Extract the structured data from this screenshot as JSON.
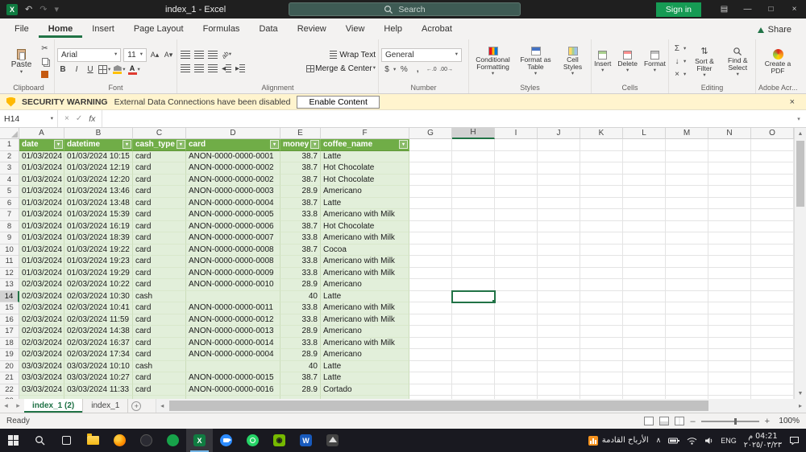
{
  "titlebar": {
    "title": "index_1 - Excel",
    "search_placeholder": "Search",
    "sign_in_label": "Sign in"
  },
  "menubar": {
    "tabs": [
      "File",
      "Home",
      "Insert",
      "Page Layout",
      "Formulas",
      "Data",
      "Review",
      "View",
      "Help",
      "Acrobat"
    ],
    "active_tab": "Home",
    "share_label": "Share"
  },
  "ribbon": {
    "clipboard": {
      "paste_label": "Paste",
      "group_label": "Clipboard"
    },
    "font": {
      "font_name": "Arial",
      "font_size": "11",
      "group_label": "Font"
    },
    "alignment": {
      "wrap_text_label": "Wrap Text",
      "merge_center_label": "Merge & Center",
      "group_label": "Alignment"
    },
    "number": {
      "format": "General",
      "group_label": "Number"
    },
    "styles": {
      "conditional_formatting_label": "Conditional Formatting",
      "format_as_table_label": "Format as Table",
      "cell_styles_label": "Cell Styles",
      "group_label": "Styles"
    },
    "cells": {
      "insert_label": "Insert",
      "delete_label": "Delete",
      "format_label": "Format",
      "group_label": "Cells"
    },
    "editing": {
      "autosum_label": "Σ",
      "sort_filter_label": "Sort & Filter",
      "find_select_label": "Find & Select",
      "group_label": "Editing"
    },
    "adobe": {
      "create_pdf_label": "Create a PDF",
      "group_label": "Adobe Acr..."
    }
  },
  "security_bar": {
    "title": "SECURITY WARNING",
    "message": "External Data Connections have been disabled",
    "button_label": "Enable Content"
  },
  "formula_bar": {
    "name_box": "H14",
    "formula_value": ""
  },
  "grid": {
    "column_letters": [
      "A",
      "B",
      "C",
      "D",
      "E",
      "F",
      "G",
      "H",
      "I",
      "J",
      "K",
      "L",
      "M",
      "N",
      "O"
    ],
    "selected_cell": {
      "column": "H",
      "row": 14
    },
    "table_headers": [
      "date",
      "datetime",
      "cash_type",
      "card",
      "money",
      "coffee_name"
    ],
    "first_row_number": 2,
    "rows": [
      [
        "01/03/2024",
        "01/03/2024 10:15",
        "card",
        "ANON-0000-0000-0001",
        "38.7",
        "Latte"
      ],
      [
        "01/03/2024",
        "01/03/2024 12:19",
        "card",
        "ANON-0000-0000-0002",
        "38.7",
        "Hot Chocolate"
      ],
      [
        "01/03/2024",
        "01/03/2024 12:20",
        "card",
        "ANON-0000-0000-0002",
        "38.7",
        "Hot Chocolate"
      ],
      [
        "01/03/2024",
        "01/03/2024 13:46",
        "card",
        "ANON-0000-0000-0003",
        "28.9",
        "Americano"
      ],
      [
        "01/03/2024",
        "01/03/2024 13:48",
        "card",
        "ANON-0000-0000-0004",
        "38.7",
        "Latte"
      ],
      [
        "01/03/2024",
        "01/03/2024 15:39",
        "card",
        "ANON-0000-0000-0005",
        "33.8",
        "Americano with Milk"
      ],
      [
        "01/03/2024",
        "01/03/2024 16:19",
        "card",
        "ANON-0000-0000-0006",
        "38.7",
        "Hot Chocolate"
      ],
      [
        "01/03/2024",
        "01/03/2024 18:39",
        "card",
        "ANON-0000-0000-0007",
        "33.8",
        "Americano with Milk"
      ],
      [
        "01/03/2024",
        "01/03/2024 19:22",
        "card",
        "ANON-0000-0000-0008",
        "38.7",
        "Cocoa"
      ],
      [
        "01/03/2024",
        "01/03/2024 19:23",
        "card",
        "ANON-0000-0000-0008",
        "33.8",
        "Americano with Milk"
      ],
      [
        "01/03/2024",
        "01/03/2024 19:29",
        "card",
        "ANON-0000-0000-0009",
        "33.8",
        "Americano with Milk"
      ],
      [
        "02/03/2024",
        "02/03/2024 10:22",
        "card",
        "ANON-0000-0000-0010",
        "28.9",
        "Americano"
      ],
      [
        "02/03/2024",
        "02/03/2024 10:30",
        "cash",
        "",
        "40",
        "Latte"
      ],
      [
        "02/03/2024",
        "02/03/2024 10:41",
        "card",
        "ANON-0000-0000-0011",
        "33.8",
        "Americano with Milk"
      ],
      [
        "02/03/2024",
        "02/03/2024 11:59",
        "card",
        "ANON-0000-0000-0012",
        "33.8",
        "Americano with Milk"
      ],
      [
        "02/03/2024",
        "02/03/2024 14:38",
        "card",
        "ANON-0000-0000-0013",
        "28.9",
        "Americano"
      ],
      [
        "02/03/2024",
        "02/03/2024 16:37",
        "card",
        "ANON-0000-0000-0014",
        "33.8",
        "Americano with Milk"
      ],
      [
        "02/03/2024",
        "02/03/2024 17:34",
        "card",
        "ANON-0000-0000-0004",
        "28.9",
        "Americano"
      ],
      [
        "03/03/2024",
        "03/03/2024 10:10",
        "cash",
        "",
        "40",
        "Latte"
      ],
      [
        "03/03/2024",
        "03/03/2024 10:27",
        "card",
        "ANON-0000-0000-0015",
        "38.7",
        "Latte"
      ],
      [
        "03/03/2024",
        "03/03/2024 11:33",
        "card",
        "ANON-0000-0000-0016",
        "28.9",
        "Cortado"
      ],
      [
        "",
        "",
        "",
        "",
        "",
        ""
      ]
    ]
  },
  "sheet_tabs": {
    "tabs": [
      "index_1 (2)",
      "index_1"
    ],
    "active_tab": "index_1 (2)"
  },
  "status_bar": {
    "mode": "Ready",
    "zoom": "100%"
  },
  "taskbar": {
    "apps": [
      "start",
      "search",
      "task-view",
      "file-explorer",
      "firefox",
      "app-dark",
      "app-green",
      "excel",
      "zoom",
      "whatsapp",
      "nvidia",
      "word",
      "photos"
    ],
    "active_app": "excel",
    "tray": {
      "news_text": "الأرباح القادمة",
      "language": "ENG",
      "time": "04:21 م",
      "date": "٢٠٢٥/٠٣/٢٣"
    }
  },
  "colors": {
    "excel_green": "#217346",
    "table_header_green": "#70AD47",
    "table_row_green": "#E2EFDA",
    "warning_yellow": "#FFF4CE"
  }
}
